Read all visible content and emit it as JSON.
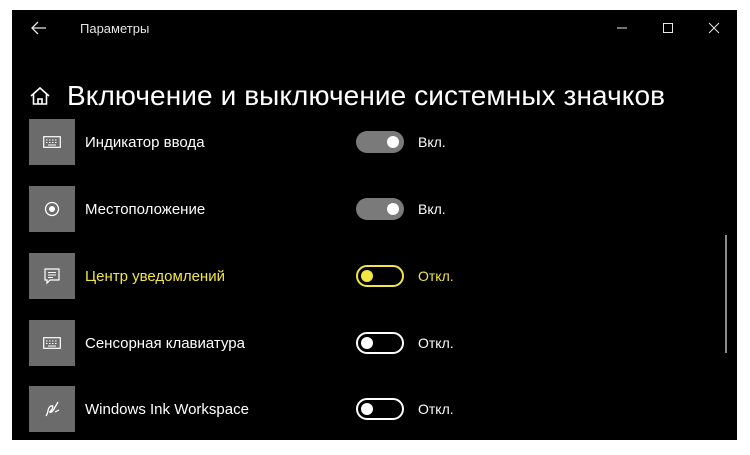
{
  "titlebar": {
    "back_icon": "back-arrow-icon",
    "title": "Параметры",
    "controls": [
      "minimize-icon",
      "maximize-icon",
      "close-icon"
    ]
  },
  "header": {
    "icon": "home-icon",
    "title": "Включение и выключение системных значков"
  },
  "items": [
    {
      "label": "Индикатор ввода",
      "icon": "keyboard-icon",
      "state": "Вкл.",
      "on": true
    },
    {
      "label": "Местоположение",
      "icon": "location-icon",
      "state": "Вкл.",
      "on": true
    },
    {
      "label": "Центр уведомлений",
      "icon": "notification-center-icon",
      "state": "Откл.",
      "on": false
    },
    {
      "label": "Сенсорная клавиатура",
      "icon": "touch-keyboard-icon",
      "state": "Откл.",
      "on": false
    },
    {
      "label": "Windows Ink Workspace",
      "icon": "windows-ink-icon",
      "state": "Откл.",
      "on": false
    }
  ],
  "colors": {
    "background": "#000000",
    "tile": "#6b6b6b",
    "highlight": "#f2e640",
    "toggle_on": "#7a7a7a"
  }
}
